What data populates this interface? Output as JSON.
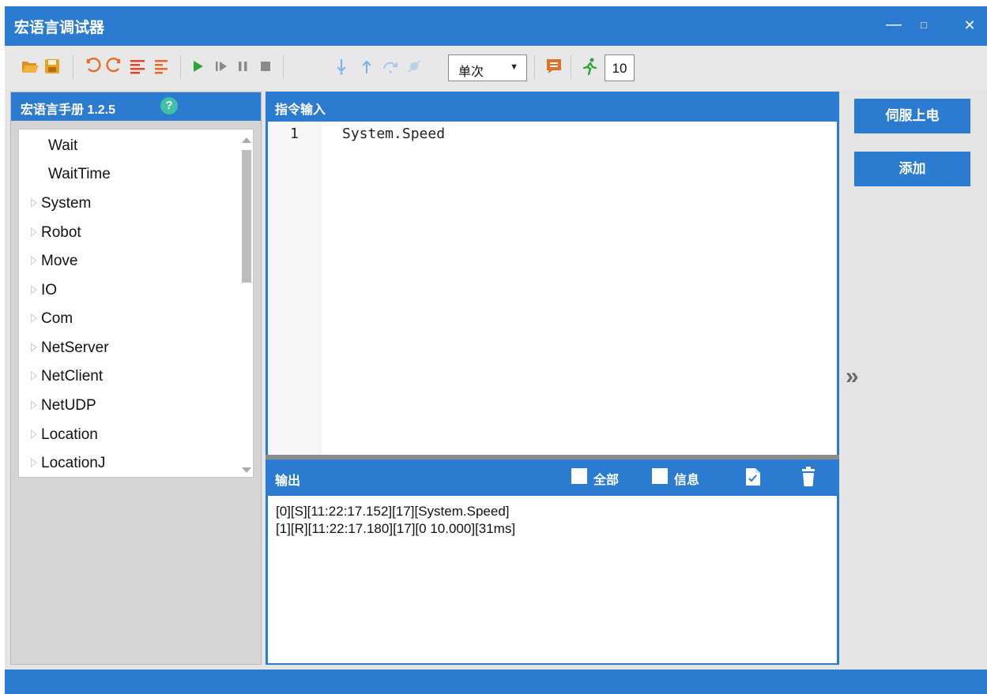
{
  "window": {
    "title": "宏语言调试器",
    "controls": {
      "minimize": "—",
      "maximize": "□",
      "close": "✕"
    }
  },
  "toolbar": {
    "icons": [
      "open-folder-icon",
      "save-icon",
      "undo-icon",
      "redo-icon",
      "comment-icon",
      "uncomment-icon",
      "run-icon",
      "step-run-icon",
      "pause-icon",
      "stop-icon",
      "step-into-icon",
      "step-out-icon",
      "step-over-icon",
      "breakpoint-icon",
      "feedback-icon",
      "speed-icon"
    ],
    "mode": {
      "selected": "单次",
      "arrow": "▼"
    },
    "speed": "10"
  },
  "manual": {
    "title": "宏语言手册 1.2.5",
    "help": "?",
    "items": [
      {
        "label": "Wait",
        "expandable": false
      },
      {
        "label": "WaitTime",
        "expandable": false
      },
      {
        "label": "System",
        "expandable": true
      },
      {
        "label": "Robot",
        "expandable": true
      },
      {
        "label": "Move",
        "expandable": true
      },
      {
        "label": "IO",
        "expandable": true
      },
      {
        "label": "Com",
        "expandable": true
      },
      {
        "label": "NetServer",
        "expandable": true
      },
      {
        "label": "NetClient",
        "expandable": true
      },
      {
        "label": "NetUDP",
        "expandable": true
      },
      {
        "label": "Location",
        "expandable": true
      },
      {
        "label": "LocationJ",
        "expandable": true
      }
    ]
  },
  "command": {
    "title": "指令输入",
    "lines": [
      {
        "num": "1",
        "text": "System.Speed"
      }
    ]
  },
  "output": {
    "title": "输出",
    "filter_all": "全部",
    "filter_info": "信息",
    "lines": [
      "[0][S][11:22:17.152][17][System.Speed]",
      "[1][R][11:22:17.180][17][0 10.000][31ms]"
    ]
  },
  "side": {
    "servo_on": "伺服上电",
    "add": "添加",
    "expand": "»"
  },
  "colors": {
    "accent": "#2b7bd0",
    "background": "#e4e4e4"
  }
}
